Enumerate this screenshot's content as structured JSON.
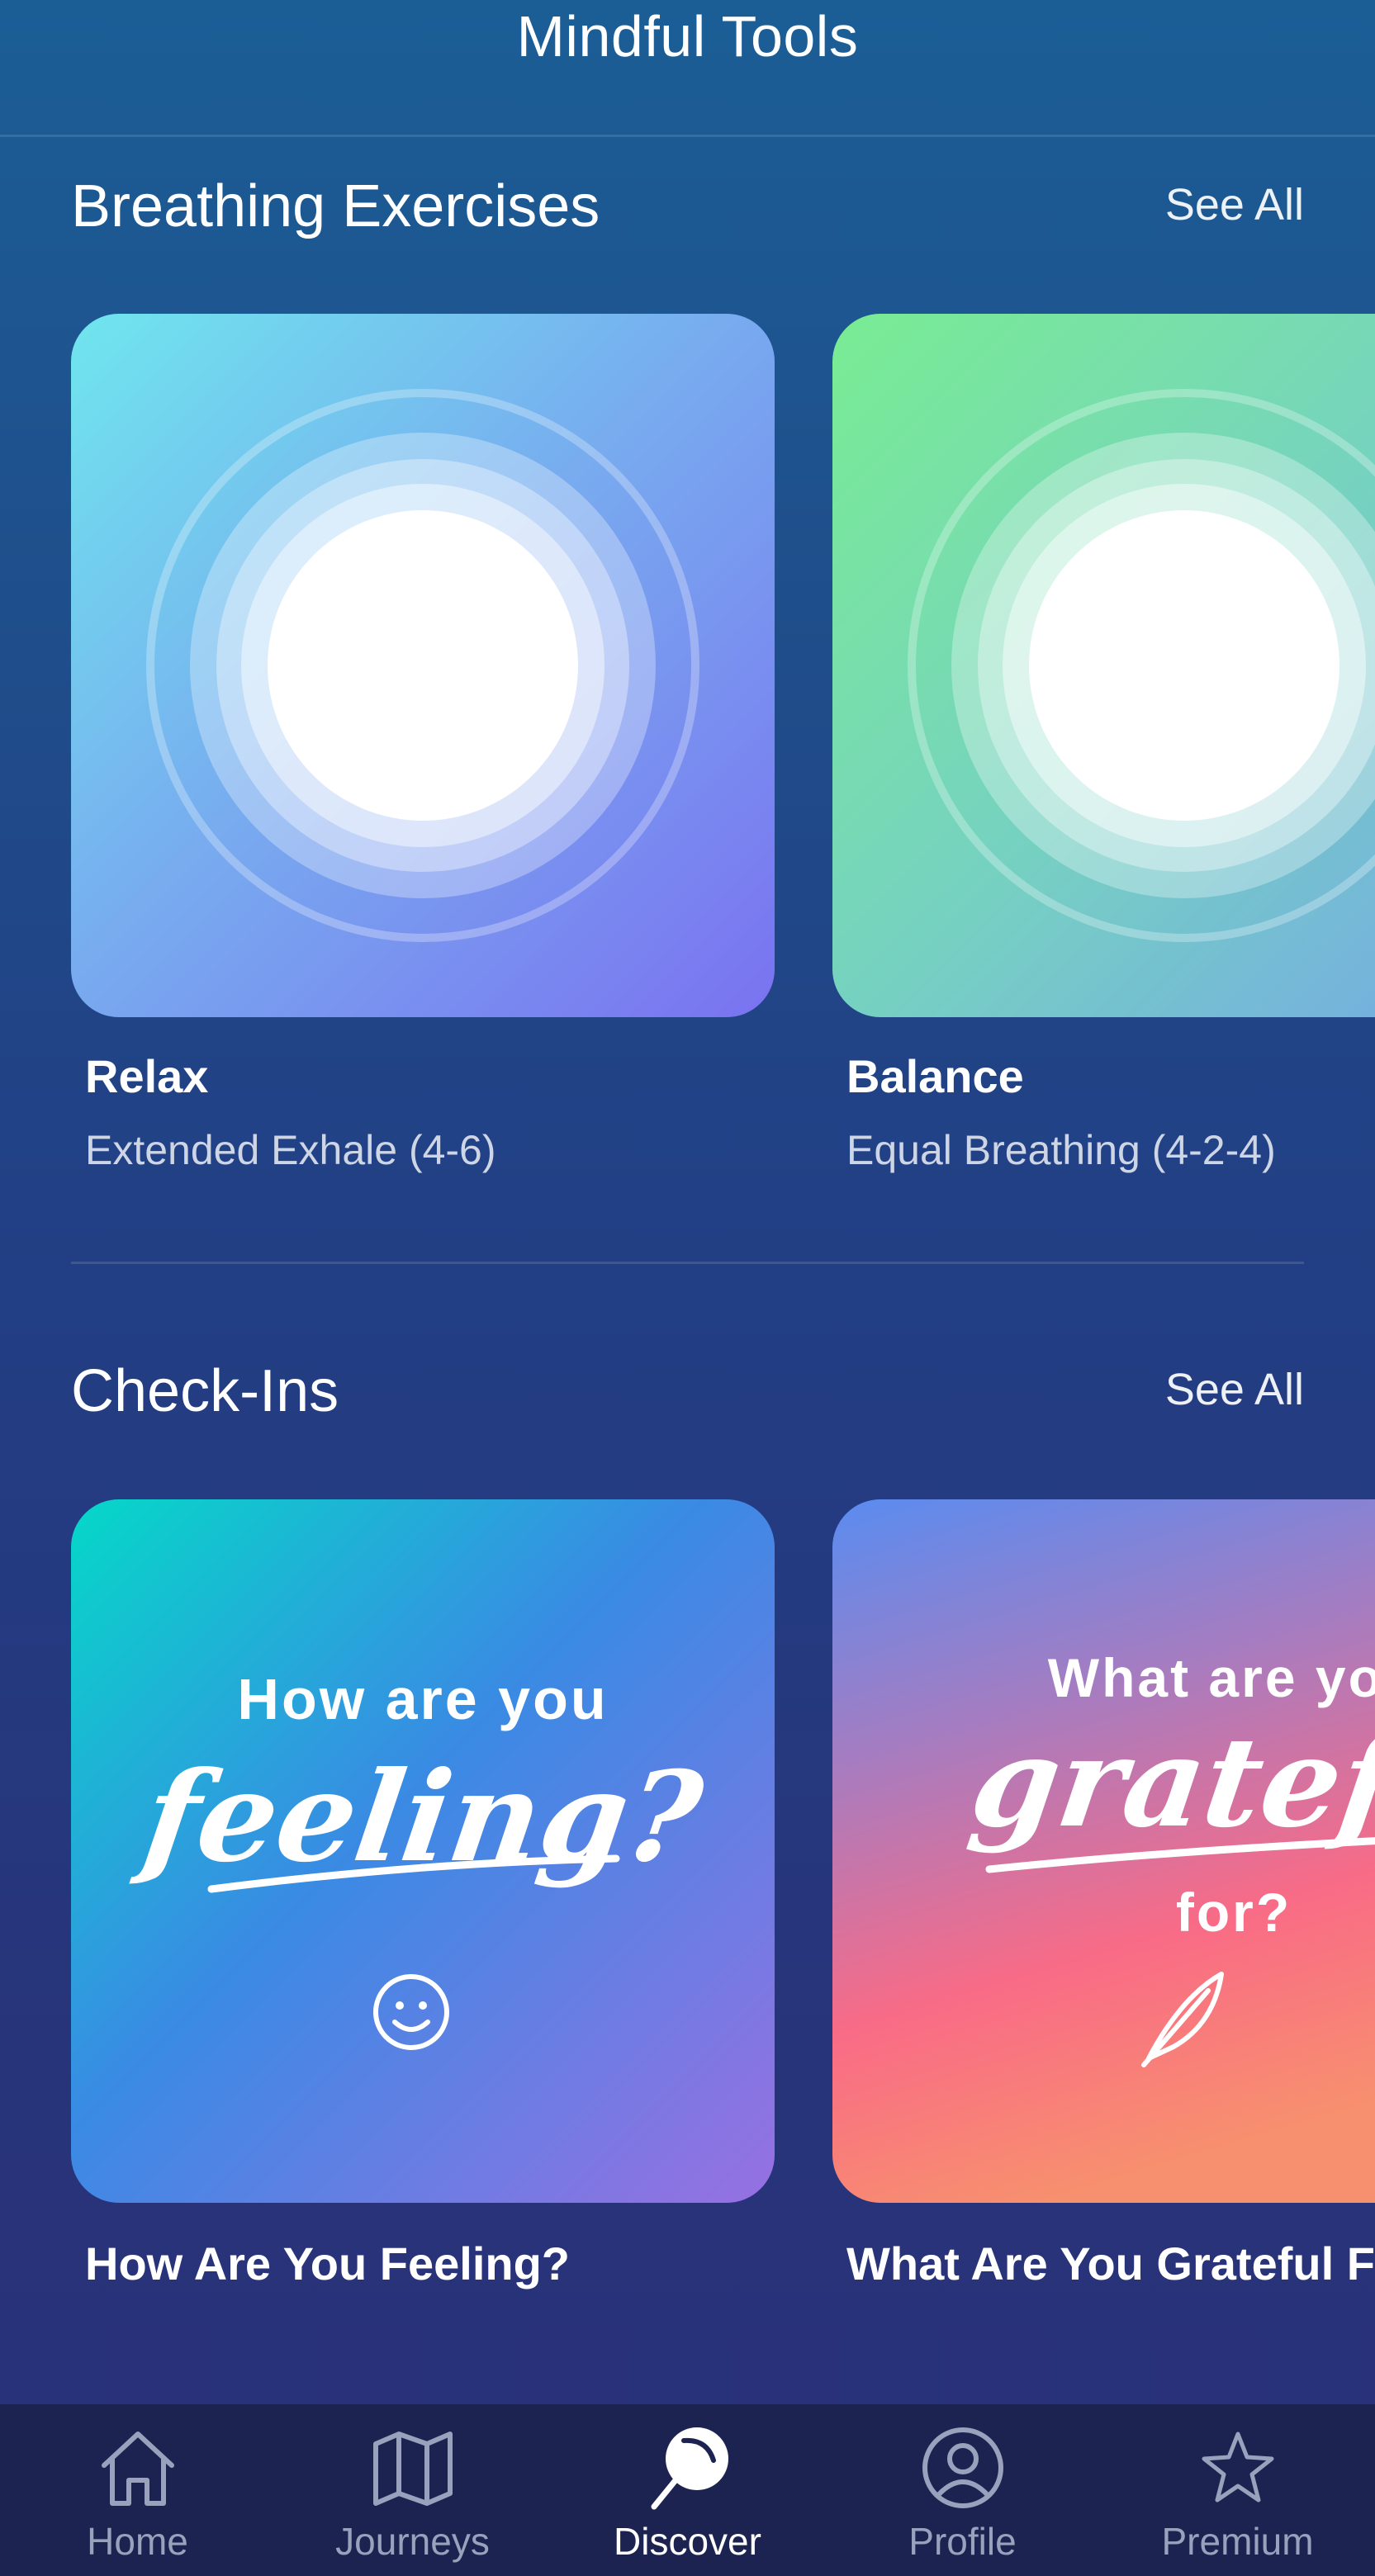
{
  "header": {
    "title": "Mindful Tools"
  },
  "breathing": {
    "section_title": "Breathing Exercises",
    "see_all_label": "See All",
    "cards": [
      {
        "title": "Relax",
        "subtitle": "Extended Exhale (4-6)"
      },
      {
        "title": "Balance",
        "subtitle": "Equal Breathing (4-2-4)"
      }
    ]
  },
  "checkins": {
    "section_title": "Check-Ins",
    "see_all_label": "See All",
    "cards": [
      {
        "title": "How Are You Feeling?",
        "art_top": "How are you",
        "art_script": "feeling?",
        "art_bottom": "",
        "art_icon": "smiley-icon"
      },
      {
        "title": "What Are You Grateful For?",
        "art_top": "What are you",
        "art_script": "grateful",
        "art_bottom": "for?",
        "art_icon": "feather-icon"
      }
    ]
  },
  "tabbar": {
    "active": "Discover",
    "tabs": [
      {
        "label": "Home",
        "icon": "home-icon"
      },
      {
        "label": "Journeys",
        "icon": "map-icon"
      },
      {
        "label": "Discover",
        "icon": "discover-icon"
      },
      {
        "label": "Profile",
        "icon": "profile-icon"
      },
      {
        "label": "Premium",
        "icon": "star-icon"
      }
    ]
  },
  "colors": {
    "background_top": "#1b5e96",
    "background_bottom": "#29317a",
    "tabbar_bg": "#1c2350",
    "tab_inactive": "#9aa1bd",
    "tab_active": "#ffffff",
    "relax_gradient": [
      "#6fe6ee",
      "#7a7bf0"
    ],
    "balance_gradient": [
      "#79ec93",
      "#74b8e0"
    ],
    "feeling_gradient": [
      "#05d8c8",
      "#3a8ae4",
      "#8e72e2"
    ],
    "grateful_gradient": [
      "#5a8cf0",
      "#f7718a",
      "#f7906e"
    ]
  }
}
